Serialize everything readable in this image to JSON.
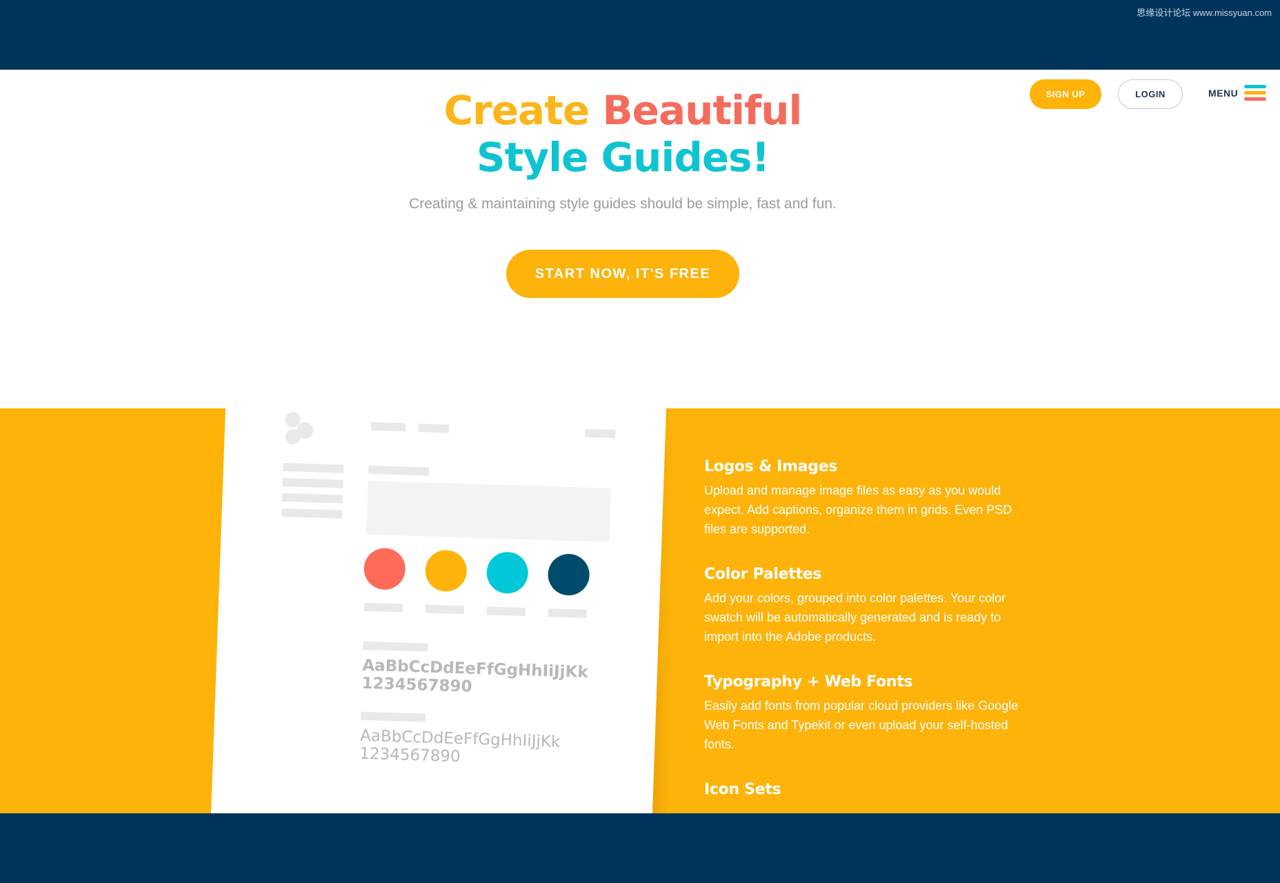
{
  "watermark": "思缘设计论坛 www.missyuan.com",
  "nav": {
    "signup_label": "SIGN UP",
    "login_label": "LOGIN",
    "menu_label": "MENU"
  },
  "hero": {
    "line1_word1": "Create",
    "line1_word2": "Beautiful",
    "line2": "Style Guides!",
    "subtitle": "Creating & maintaining style guides should be simple, fast and fun.",
    "cta_label": "START NOW, IT'S FREE"
  },
  "mockup": {
    "swatch_colors": [
      "#fe6b58",
      "#fdb30a",
      "#00c8d8",
      "#004b6b"
    ],
    "type_sample_1": "AaBbCcDdEeFfGgHhIiJjKk",
    "type_sample_1_digits": "1234567890",
    "type_sample_2": "AaBbCcDdEeFfGgHhIiJjKk",
    "type_sample_2_digits": "1234567890"
  },
  "features": [
    {
      "title": "Logos & Images",
      "body": "Upload and manage image files as easy as you would expect. Add captions, organize them in grids. Even PSD files are supported."
    },
    {
      "title": "Color Palettes",
      "body": "Add your colors, grouped into color palettes. Your color swatch will be automatically generated and is ready to import into the Adobe products."
    },
    {
      "title": "Typography + Web Fonts",
      "body": "Easily add fonts from popular cloud providers like Google Web Fonts and Typekit or even upload your self-hosted fonts."
    },
    {
      "title": "Icon Sets",
      "body": ""
    }
  ],
  "colors": {
    "navy": "#01345b",
    "yellow": "#fdb30a",
    "coral": "#f56c5c",
    "teal": "#0ec4d2"
  }
}
